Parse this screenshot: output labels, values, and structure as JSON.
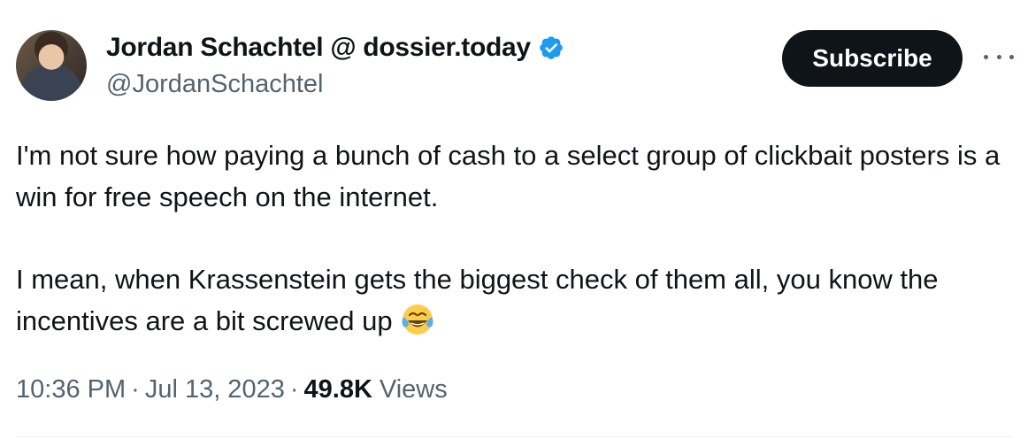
{
  "author": {
    "display_name": "Jordan Schachtel @ dossier.today",
    "handle": "@JordanSchachtel",
    "verified_color": "#1d9bf0"
  },
  "actions": {
    "subscribe_label": "Subscribe",
    "more_icon": "more-horizontal-icon"
  },
  "tweet": {
    "paragraph_1": "I'm not sure how paying a bunch of cash to a select group of clickbait posters is a win for free speech on the internet.",
    "paragraph_2": "I mean, when Krassenstein gets the biggest check of them all, you know the incentives are a bit screwed up",
    "emoji": "face-with-tears-of-joy-icon"
  },
  "meta": {
    "time": "10:36 PM",
    "separator": "·",
    "date": "Jul 13, 2023",
    "views_count": "49.8K",
    "views_label": "Views"
  }
}
